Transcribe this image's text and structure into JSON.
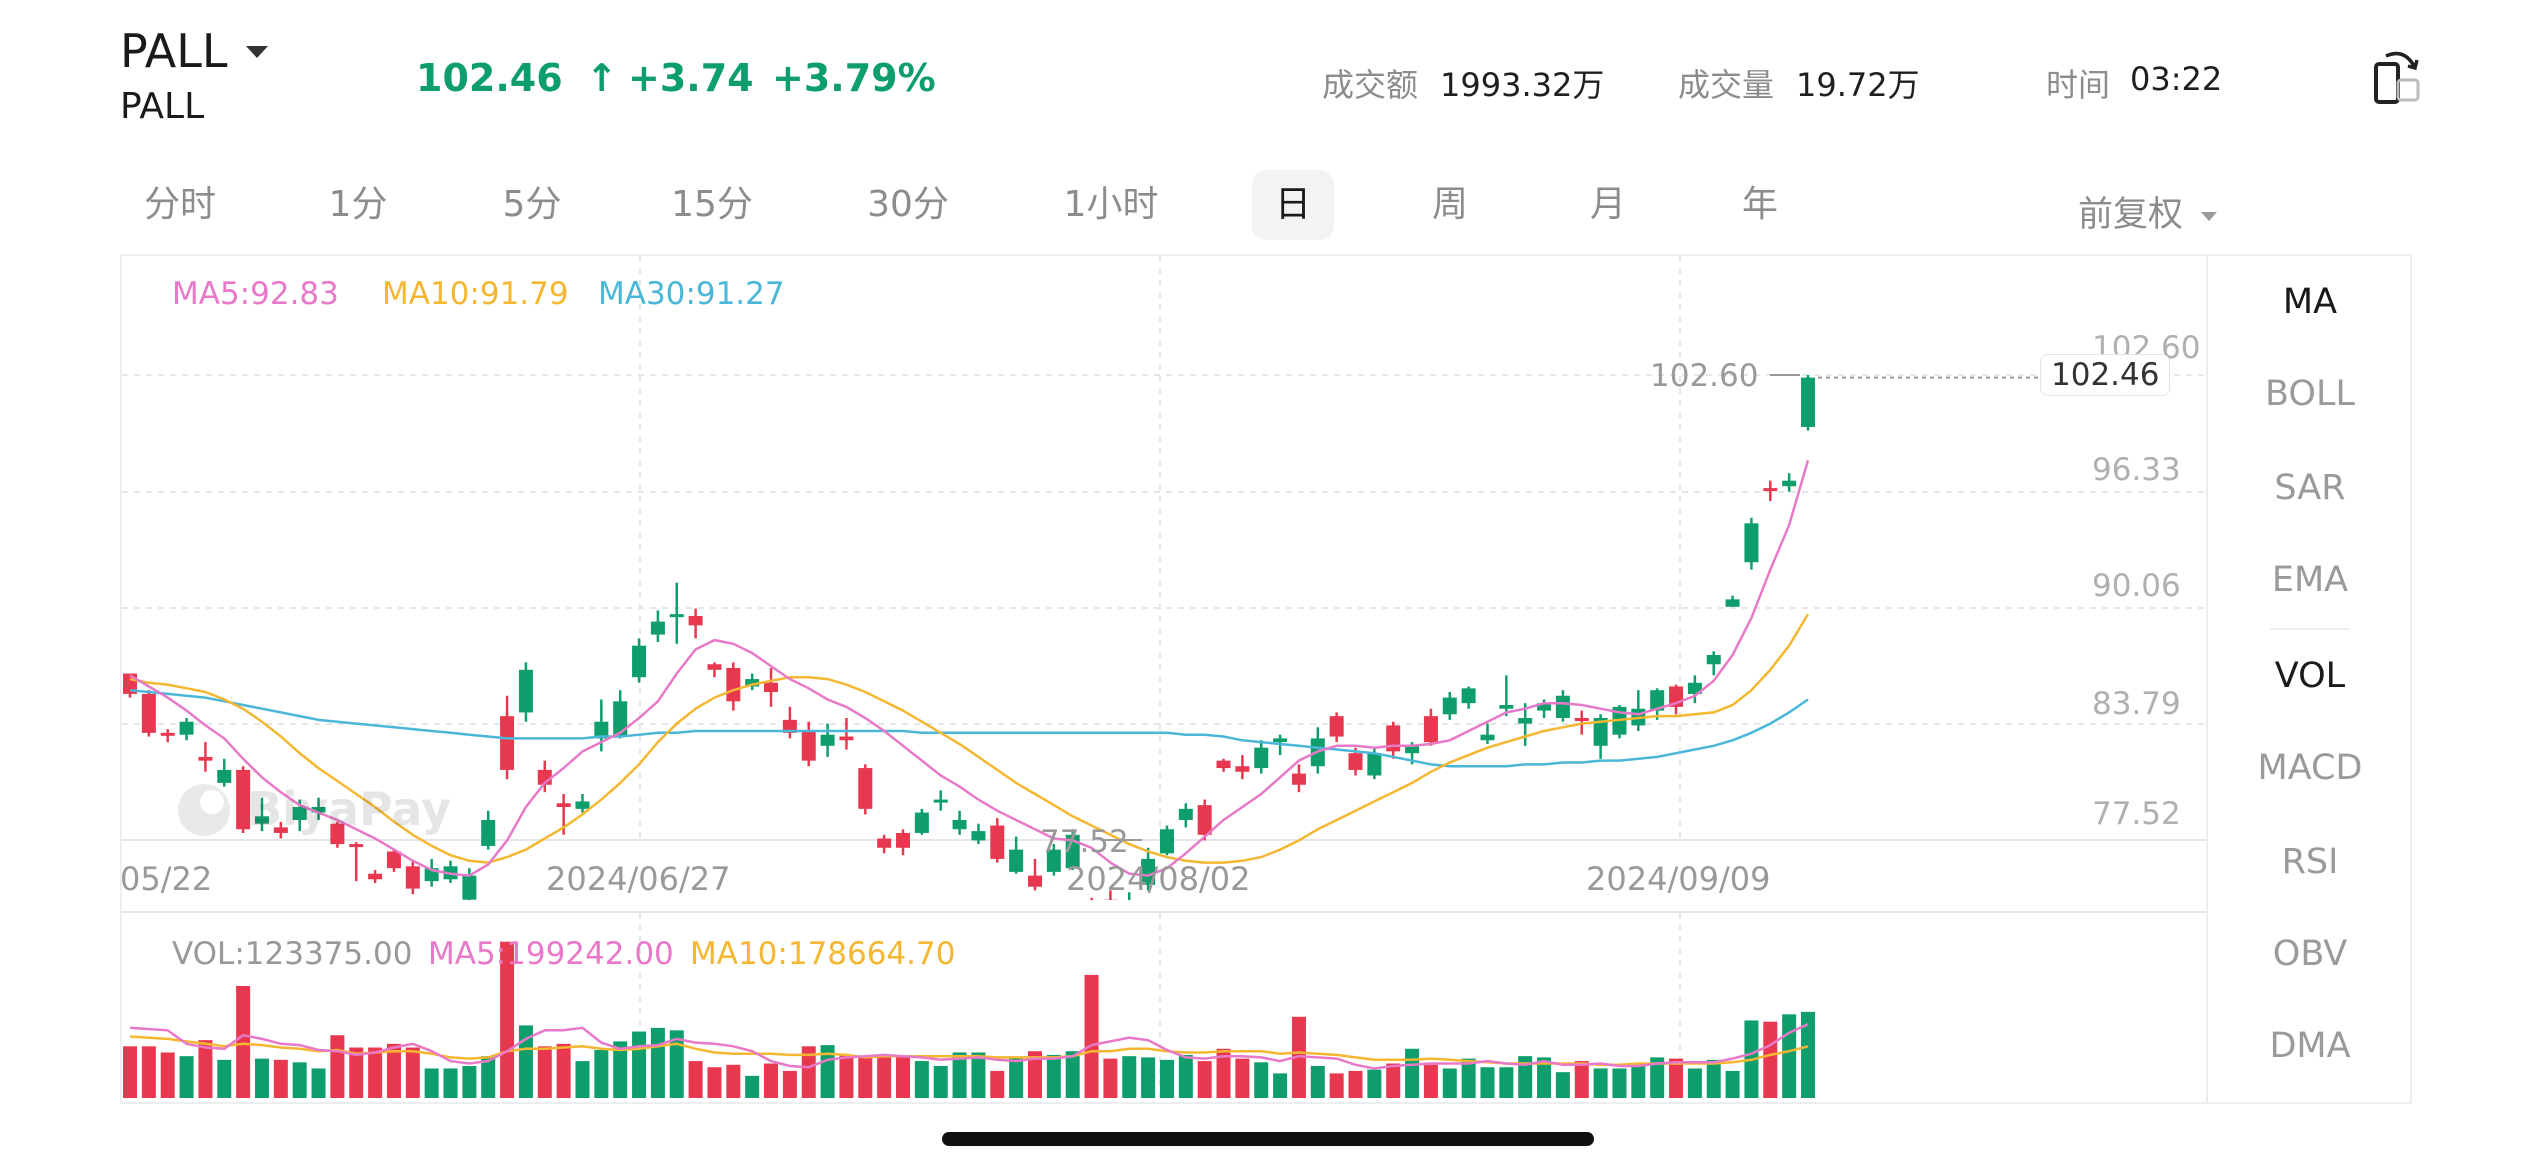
{
  "header": {
    "symbol": "PALL",
    "dropdown_icon": "caret-down-icon",
    "subtitle": "PALL",
    "price": "102.46",
    "arrow": "↑",
    "change": "+3.74",
    "change_pct": "+3.79%",
    "turnover_label": "成交额",
    "turnover_value": "1993.32万",
    "volume_label": "成交量",
    "volume_value": "19.72万",
    "time_label": "时间",
    "time_value": "03:22",
    "rotate_icon": "rotate-screen-icon"
  },
  "tabs": [
    "分时",
    "1分",
    "5分",
    "15分",
    "30分",
    "1小时",
    "日",
    "周",
    "月",
    "年"
  ],
  "active_tab": "日",
  "adjust_label": "前复权",
  "indicators": {
    "main": [
      "MA",
      "BOLL",
      "SAR",
      "EMA"
    ],
    "sub": [
      "VOL",
      "MACD",
      "RSI",
      "OBV",
      "DMA"
    ],
    "active_main": "MA",
    "active_sub": "VOL"
  },
  "ma_legend": {
    "ma5": "MA5:92.83",
    "ma10": "MA10:91.79",
    "ma30": "MA30:91.27"
  },
  "vol_legend": {
    "vol": "VOL:123375.00",
    "ma5": "MA5:199242.00",
    "ma10": "MA10:178664.70"
  },
  "y_axis_labels": [
    "102.60",
    "96.33",
    "90.06",
    "83.79",
    "77.52"
  ],
  "x_axis_labels": [
    "05/22",
    "2024/06/27",
    "2024/08/02",
    "2024/09/09"
  ],
  "high_marker": "102.60",
  "low_marker": "77.52",
  "last_price_label": "102.46",
  "watermark": "BiyaPay",
  "colors": {
    "up": "#0e9e6b",
    "down": "#e8384f",
    "ma5": "#e879c9",
    "ma10": "#f5b731",
    "ma30": "#4ab7d9"
  },
  "chart_data": {
    "type": "candlestick",
    "ylim": [
      77.52,
      102.6
    ],
    "ohlc": [
      [
        86.5,
        86.5,
        85.2,
        85.4
      ],
      [
        85.4,
        85.6,
        83.1,
        83.3
      ],
      [
        83.3,
        83.5,
        82.8,
        83.2
      ],
      [
        83.2,
        84.1,
        82.9,
        83.9
      ],
      [
        82.0,
        82.8,
        81.2,
        81.8
      ],
      [
        80.6,
        81.9,
        80.4,
        81.3
      ],
      [
        81.3,
        81.5,
        77.9,
        78.1
      ],
      [
        78.4,
        79.8,
        78.0,
        78.8
      ],
      [
        78.2,
        78.5,
        77.6,
        77.9
      ],
      [
        78.6,
        79.7,
        78.0,
        79.3
      ],
      [
        79.0,
        79.8,
        78.6,
        79.3
      ],
      [
        78.4,
        78.5,
        77.1,
        77.3
      ],
      [
        77.3,
        77.4,
        75.3,
        77.2
      ],
      [
        75.7,
        75.9,
        75.2,
        75.4
      ],
      [
        76.9,
        77.0,
        75.8,
        76.0
      ],
      [
        76.1,
        76.4,
        74.6,
        74.9
      ],
      [
        75.3,
        76.5,
        75.0,
        76.0
      ],
      [
        75.4,
        76.4,
        75.2,
        76.1
      ],
      [
        74.3,
        76.0,
        74.0,
        75.6
      ],
      [
        77.2,
        79.1,
        77.0,
        78.6
      ],
      [
        84.2,
        85.3,
        80.8,
        81.3
      ],
      [
        84.4,
        87.1,
        83.9,
        86.7
      ],
      [
        81.3,
        81.8,
        80.1,
        80.5
      ],
      [
        79.5,
        80.0,
        77.8,
        79.3
      ],
      [
        79.2,
        80.0,
        79.0,
        79.6
      ],
      [
        83.0,
        85.1,
        82.3,
        83.9
      ],
      [
        83.1,
        85.6,
        83.0,
        85.0
      ],
      [
        86.3,
        88.4,
        86.0,
        88.0
      ],
      [
        88.6,
        89.9,
        88.2,
        89.3
      ],
      [
        89.6,
        91.4,
        88.1,
        89.7
      ],
      [
        89.6,
        90.0,
        88.4,
        89.1
      ],
      [
        87.0,
        87.1,
        86.3,
        86.7
      ],
      [
        86.8,
        87.1,
        84.5,
        85.0
      ],
      [
        85.8,
        86.5,
        85.6,
        86.2
      ],
      [
        86.0,
        86.8,
        84.7,
        85.5
      ],
      [
        84.0,
        84.7,
        83.0,
        83.3
      ],
      [
        83.4,
        83.9,
        81.5,
        81.8
      ],
      [
        82.6,
        83.8,
        82.0,
        83.2
      ],
      [
        83.1,
        84.1,
        82.4,
        82.9
      ],
      [
        81.4,
        81.6,
        78.9,
        79.2
      ],
      [
        77.6,
        77.8,
        76.8,
        77.1
      ],
      [
        77.9,
        78.1,
        76.7,
        77.1
      ],
      [
        77.9,
        79.2,
        77.8,
        79.0
      ],
      [
        79.6,
        80.2,
        79.1,
        79.7
      ],
      [
        78.1,
        79.1,
        77.8,
        78.6
      ],
      [
        77.5,
        78.4,
        77.3,
        78.0
      ],
      [
        78.3,
        78.7,
        76.3,
        76.5
      ],
      [
        75.8,
        77.7,
        75.7,
        77.0
      ],
      [
        75.6,
        76.5,
        74.8,
        75.0
      ],
      [
        75.8,
        77.3,
        75.6,
        77.0
      ],
      [
        76.0,
        78.1,
        75.9,
        77.8
      ],
      [
        73.9,
        74.4,
        73.1,
        73.4
      ],
      [
        74.3,
        74.8,
        71.4,
        71.6
      ],
      [
        72.8,
        74.7,
        72.5,
        74.1
      ],
      [
        75.1,
        77.1,
        74.8,
        76.5
      ],
      [
        76.8,
        78.3,
        76.7,
        78.1
      ],
      [
        78.6,
        79.5,
        78.2,
        79.2
      ],
      [
        79.4,
        79.7,
        77.5,
        77.8
      ],
      [
        81.8,
        81.9,
        81.2,
        81.4
      ],
      [
        81.5,
        82.1,
        80.8,
        81.2
      ],
      [
        81.4,
        82.9,
        81.1,
        82.5
      ],
      [
        82.8,
        83.2,
        82.1,
        83.0
      ],
      [
        81.1,
        81.6,
        80.1,
        80.5
      ],
      [
        81.5,
        83.6,
        81.1,
        83.0
      ],
      [
        84.2,
        84.4,
        82.8,
        83.1
      ],
      [
        82.2,
        82.5,
        81.0,
        81.3
      ],
      [
        81.0,
        82.5,
        80.8,
        82.2
      ],
      [
        83.7,
        83.9,
        81.9,
        82.3
      ],
      [
        82.2,
        82.8,
        81.6,
        82.6
      ],
      [
        84.2,
        84.6,
        82.6,
        82.8
      ],
      [
        84.3,
        85.5,
        84.0,
        85.2
      ],
      [
        84.9,
        85.8,
        84.6,
        85.7
      ],
      [
        82.9,
        83.8,
        82.7,
        83.2
      ],
      [
        84.6,
        86.4,
        84.2,
        84.8
      ],
      [
        83.8,
        84.9,
        82.6,
        84.1
      ],
      [
        84.5,
        85.1,
        84.1,
        84.9
      ],
      [
        84.1,
        85.6,
        83.9,
        85.3
      ],
      [
        84.1,
        84.5,
        83.2,
        84.0
      ],
      [
        82.6,
        84.3,
        81.9,
        84.1
      ],
      [
        83.2,
        84.8,
        83.0,
        84.7
      ],
      [
        83.7,
        85.6,
        83.4,
        84.6
      ],
      [
        84.5,
        85.7,
        84.0,
        85.6
      ],
      [
        85.8,
        85.9,
        84.3,
        84.7
      ],
      [
        85.4,
        86.4,
        84.9,
        86.0
      ],
      [
        87.0,
        87.7,
        86.4,
        87.5
      ],
      [
        90.1,
        90.7,
        90.1,
        90.5
      ],
      [
        92.5,
        94.9,
        92.1,
        94.6
      ],
      [
        96.5,
        96.9,
        95.8,
        96.4
      ],
      [
        96.6,
        97.3,
        96.3,
        96.9
      ],
      [
        99.8,
        102.6,
        99.6,
        102.46
      ]
    ],
    "ma5": [
      86.4,
      85.8,
      85.2,
      84.5,
      83.7,
      83.0,
      81.9,
      80.9,
      80.1,
      79.4,
      79.0,
      78.6,
      78.1,
      77.6,
      77.0,
      76.4,
      75.9,
      75.7,
      75.6,
      76.2,
      77.5,
      79.3,
      80.6,
      81.4,
      82.3,
      82.8,
      83.3,
      84.1,
      85.0,
      86.5,
      87.8,
      88.3,
      88.1,
      87.6,
      86.9,
      86.2,
      85.7,
      85.1,
      84.7,
      84.1,
      83.4,
      82.6,
      81.8,
      81.0,
      80.4,
      79.7,
      79.1,
      78.6,
      78.1,
      77.6,
      77.5,
      77.1,
      76.3,
      75.7,
      75.6,
      76.0,
      76.8,
      77.7,
      78.6,
      79.3,
      80.0,
      80.9,
      81.8,
      82.3,
      82.6,
      82.6,
      82.5,
      82.6,
      82.6,
      82.7,
      82.9,
      83.4,
      83.9,
      84.4,
      84.6,
      84.9,
      84.9,
      84.8,
      84.6,
      84.4,
      84.3,
      84.6,
      84.9,
      85.3,
      86.1,
      87.5,
      89.5,
      92.1,
      94.5,
      98.0
    ],
    "ma10": [
      86.2,
      86.0,
      85.9,
      85.7,
      85.5,
      85.1,
      84.6,
      83.9,
      83.1,
      82.2,
      81.4,
      80.7,
      80.0,
      79.3,
      78.5,
      77.8,
      77.2,
      76.7,
      76.4,
      76.3,
      76.6,
      77.0,
      77.6,
      78.2,
      78.9,
      79.7,
      80.6,
      81.6,
      82.8,
      83.8,
      84.6,
      85.2,
      85.6,
      85.9,
      86.1,
      86.3,
      86.3,
      86.2,
      85.9,
      85.5,
      85.0,
      84.5,
      83.9,
      83.3,
      82.7,
      82.0,
      81.3,
      80.6,
      80.0,
      79.4,
      78.8,
      78.3,
      77.8,
      77.3,
      76.9,
      76.6,
      76.4,
      76.3,
      76.3,
      76.4,
      76.6,
      77.0,
      77.5,
      78.1,
      78.6,
      79.1,
      79.6,
      80.1,
      80.6,
      81.2,
      81.7,
      82.1,
      82.5,
      82.8,
      83.1,
      83.4,
      83.6,
      83.8,
      83.9,
      84.0,
      84.1,
      84.2,
      84.2,
      84.3,
      84.4,
      84.8,
      85.6,
      86.7,
      88.0,
      89.7
    ],
    "ma30": [
      85.6,
      85.5,
      85.4,
      85.3,
      85.2,
      85.0,
      84.8,
      84.6,
      84.4,
      84.2,
      84.0,
      83.9,
      83.8,
      83.7,
      83.6,
      83.5,
      83.4,
      83.3,
      83.2,
      83.1,
      83.0,
      83.0,
      83.0,
      83.0,
      83.0,
      83.1,
      83.1,
      83.2,
      83.3,
      83.3,
      83.4,
      83.4,
      83.4,
      83.4,
      83.4,
      83.4,
      83.4,
      83.4,
      83.4,
      83.4,
      83.4,
      83.4,
      83.3,
      83.3,
      83.3,
      83.3,
      83.3,
      83.3,
      83.3,
      83.3,
      83.3,
      83.3,
      83.3,
      83.3,
      83.3,
      83.3,
      83.2,
      83.2,
      83.1,
      82.9,
      82.8,
      82.7,
      82.6,
      82.5,
      82.4,
      82.3,
      82.2,
      82.0,
      81.8,
      81.6,
      81.5,
      81.5,
      81.5,
      81.5,
      81.6,
      81.6,
      81.7,
      81.7,
      81.8,
      81.8,
      81.9,
      82.0,
      82.2,
      82.4,
      82.6,
      82.9,
      83.3,
      83.8,
      84.4,
      85.1
    ],
    "volume": [
      0.42,
      0.42,
      0.37,
      0.34,
      0.47,
      0.31,
      0.91,
      0.32,
      0.31,
      0.29,
      0.24,
      0.51,
      0.41,
      0.41,
      0.44,
      0.41,
      0.24,
      0.24,
      0.26,
      0.34,
      1.27,
      0.59,
      0.42,
      0.44,
      0.3,
      0.39,
      0.46,
      0.54,
      0.57,
      0.55,
      0.3,
      0.25,
      0.27,
      0.18,
      0.28,
      0.22,
      0.42,
      0.43,
      0.35,
      0.33,
      0.34,
      0.33,
      0.3,
      0.26,
      0.37,
      0.37,
      0.22,
      0.33,
      0.38,
      0.35,
      0.38,
      1.0,
      0.32,
      0.34,
      0.33,
      0.31,
      0.35,
      0.3,
      0.4,
      0.32,
      0.29,
      0.2,
      0.66,
      0.26,
      0.2,
      0.22,
      0.23,
      0.28,
      0.4,
      0.27,
      0.24,
      0.32,
      0.25,
      0.25,
      0.34,
      0.33,
      0.21,
      0.3,
      0.24,
      0.24,
      0.28,
      0.33,
      0.32,
      0.24,
      0.31,
      0.22,
      0.63,
      0.62,
      0.68,
      0.7
    ],
    "vol_ma5": [
      0.57,
      0.56,
      0.55,
      0.44,
      0.41,
      0.4,
      0.51,
      0.48,
      0.44,
      0.43,
      0.39,
      0.38,
      0.35,
      0.37,
      0.41,
      0.44,
      0.38,
      0.3,
      0.28,
      0.3,
      0.38,
      0.48,
      0.55,
      0.55,
      0.57,
      0.45,
      0.4,
      0.42,
      0.43,
      0.48,
      0.45,
      0.44,
      0.42,
      0.38,
      0.3,
      0.26,
      0.25,
      0.31,
      0.33,
      0.34,
      0.35,
      0.34,
      0.33,
      0.31,
      0.32,
      0.33,
      0.31,
      0.3,
      0.32,
      0.32,
      0.34,
      0.43,
      0.46,
      0.49,
      0.47,
      0.39,
      0.33,
      0.32,
      0.34,
      0.34,
      0.33,
      0.3,
      0.34,
      0.33,
      0.32,
      0.27,
      0.24,
      0.26,
      0.27,
      0.28,
      0.28,
      0.28,
      0.3,
      0.28,
      0.27,
      0.3,
      0.27,
      0.27,
      0.28,
      0.26,
      0.26,
      0.28,
      0.29,
      0.29,
      0.29,
      0.32,
      0.36,
      0.43,
      0.53,
      0.6
    ],
    "vol_ma10": [
      0.5,
      0.49,
      0.48,
      0.46,
      0.44,
      0.42,
      0.44,
      0.43,
      0.41,
      0.4,
      0.38,
      0.39,
      0.36,
      0.37,
      0.38,
      0.38,
      0.36,
      0.33,
      0.32,
      0.33,
      0.38,
      0.4,
      0.4,
      0.41,
      0.42,
      0.4,
      0.39,
      0.4,
      0.42,
      0.44,
      0.4,
      0.37,
      0.36,
      0.36,
      0.36,
      0.35,
      0.35,
      0.36,
      0.35,
      0.33,
      0.34,
      0.34,
      0.34,
      0.34,
      0.34,
      0.34,
      0.33,
      0.33,
      0.33,
      0.33,
      0.34,
      0.38,
      0.38,
      0.4,
      0.4,
      0.38,
      0.37,
      0.37,
      0.38,
      0.38,
      0.38,
      0.36,
      0.37,
      0.36,
      0.35,
      0.33,
      0.31,
      0.31,
      0.31,
      0.32,
      0.31,
      0.3,
      0.29,
      0.28,
      0.28,
      0.28,
      0.28,
      0.28,
      0.27,
      0.27,
      0.28,
      0.28,
      0.28,
      0.28,
      0.28,
      0.29,
      0.31,
      0.35,
      0.38,
      0.42
    ],
    "vol_max": 1.3
  }
}
